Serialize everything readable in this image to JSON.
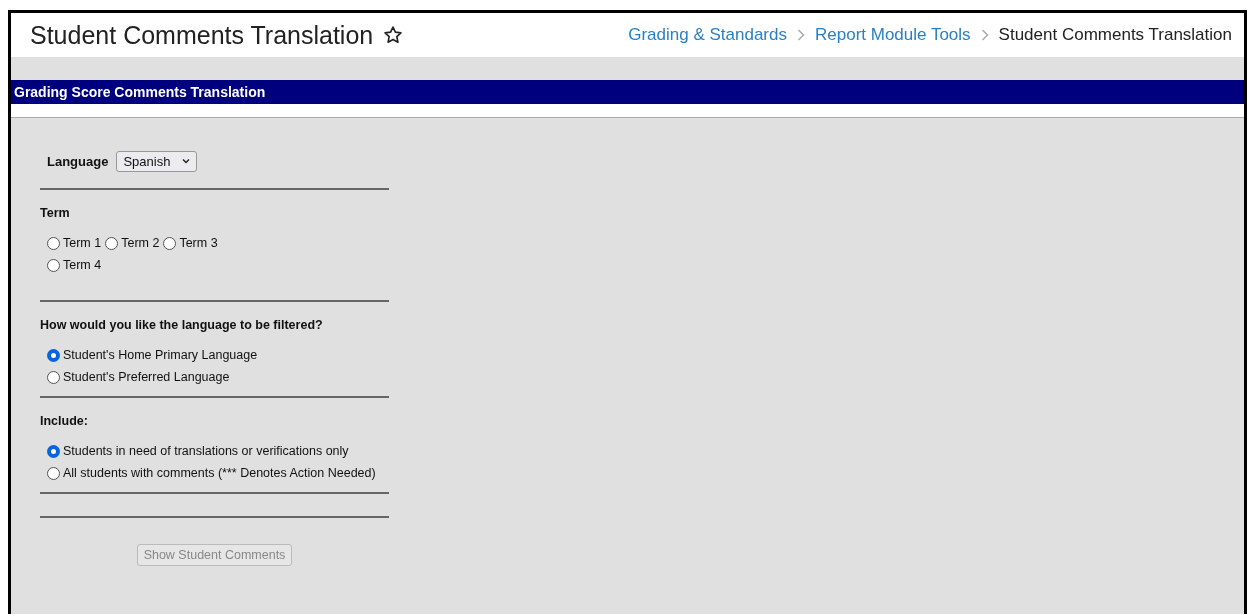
{
  "header": {
    "title": "Student Comments Translation",
    "favorite": false,
    "breadcrumbs": [
      {
        "label": "Grading & Standards",
        "kind": "link"
      },
      {
        "label": "Report Module Tools",
        "kind": "link"
      },
      {
        "label": "Student Comments Translation",
        "kind": "current"
      }
    ]
  },
  "section_title": "Grading Score Comments Translation",
  "language": {
    "label": "Language",
    "value": "Spanish"
  },
  "term": {
    "label": "Term",
    "options": [
      {
        "label": "Term 1",
        "selected": false
      },
      {
        "label": "Term 2",
        "selected": false
      },
      {
        "label": "Term 3",
        "selected": false
      },
      {
        "label": "Term 4",
        "selected": false
      }
    ]
  },
  "filter": {
    "label": "How would you like the language to be filtered?",
    "options": [
      {
        "label": "Student's Home Primary Language",
        "selected": true
      },
      {
        "label": "Student's Preferred Language",
        "selected": false
      }
    ]
  },
  "include": {
    "label": "Include:",
    "options": [
      {
        "label": "Students in need of translations or verifications only",
        "selected": true
      },
      {
        "label": "All students with comments (*** Denotes Action Needed)",
        "selected": false
      }
    ]
  },
  "submit": {
    "label": "Show Student Comments",
    "disabled": true
  }
}
